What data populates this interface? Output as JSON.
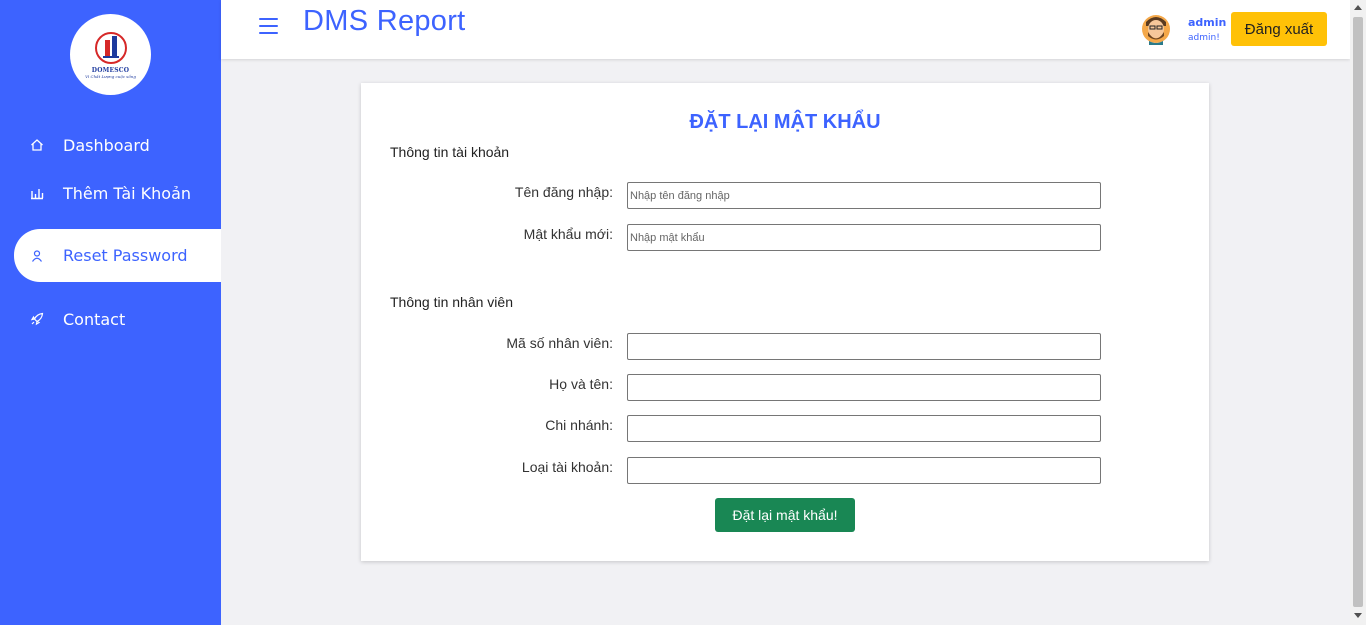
{
  "app": {
    "title": "DMS Report",
    "brand_color": "#3d63ff"
  },
  "logo": {
    "brand": "DOMESCO",
    "slogan": "Vì Chất Lượng cuộc sống"
  },
  "sidebar": {
    "items": [
      {
        "label": "Dashboard",
        "icon": "home-icon"
      },
      {
        "label": "Thêm Tài Khoản",
        "icon": "bar-chart-icon"
      },
      {
        "label": "Reset Password",
        "icon": "user-icon",
        "active": true
      },
      {
        "label": "Contact",
        "icon": "rocket-icon"
      }
    ]
  },
  "header": {
    "user_name": "admin",
    "user_role": "admin!",
    "logout_label": "Đăng xuất"
  },
  "form": {
    "title": "ĐẶT LẠI MẬT KHẨU",
    "account_section": "Thông tin tài khoản",
    "username_label": "Tên đăng nhập:",
    "username_placeholder": "Nhập tên đăng nhập",
    "username_value": "",
    "password_label": "Mật khẩu mới:",
    "password_placeholder": "Nhập mật khẩu",
    "password_value": "",
    "employee_section": "Thông tin nhân viên",
    "employee_id_label": "Mã số nhân viên:",
    "employee_id_value": "",
    "fullname_label": "Họ và tên:",
    "fullname_value": "",
    "branch_label": "Chi nhánh:",
    "branch_value": "",
    "account_type_label": "Loại tài khoản:",
    "account_type_value": "",
    "submit_label": "Đặt lại mật khẩu!"
  },
  "colors": {
    "sidebar_bg": "#3d63ff",
    "logout_bg": "#ffc107",
    "submit_bg": "#198754",
    "page_bg": "#f1f1f4"
  }
}
